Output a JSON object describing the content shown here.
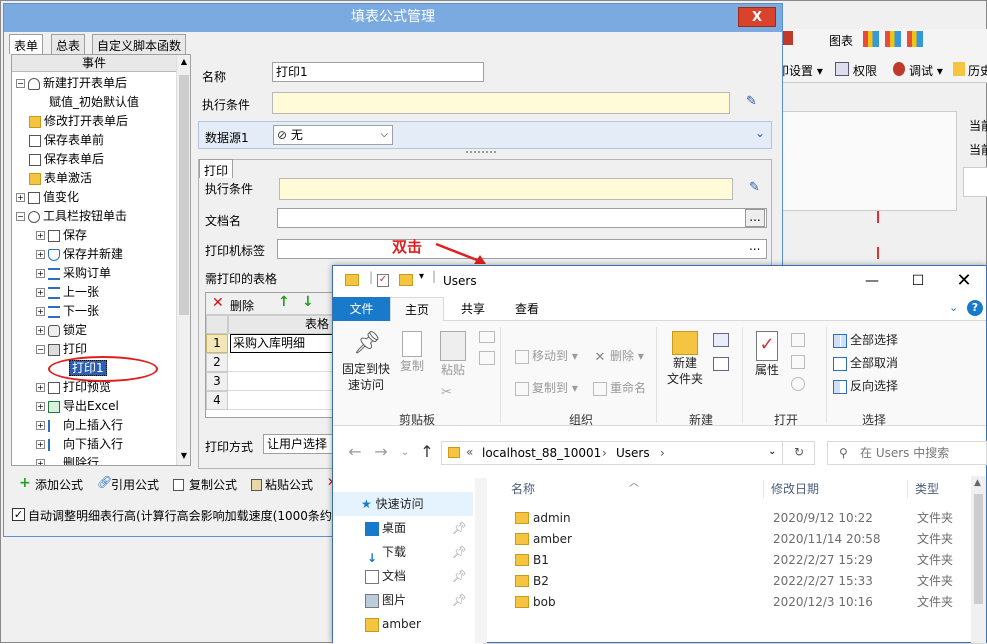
{
  "bg_app": {
    "toolbar_items": [
      "图表",
      "印设置 ▾",
      "权限",
      "调试 ▾",
      "历史"
    ],
    "side_labels": [
      "当前",
      "当前"
    ]
  },
  "dialog": {
    "title": "填表公式管理",
    "close_label": "X",
    "tabs": [
      "表单",
      "总表",
      "自定义脚本函数"
    ],
    "tree_header": "事件",
    "tree": [
      {
        "label": "新建打开表单后",
        "level": 0,
        "exp": "−",
        "icon": "person"
      },
      {
        "label": "赋值_初始默认值",
        "level": 1,
        "exp": "",
        "icon": "none"
      },
      {
        "label": "修改打开表单后",
        "level": 0,
        "exp": "",
        "icon": "folder"
      },
      {
        "label": "保存表单前",
        "level": 0,
        "exp": "",
        "icon": "doc"
      },
      {
        "label": "保存表单后",
        "level": 0,
        "exp": "",
        "icon": "doc"
      },
      {
        "label": "表单激活",
        "level": 0,
        "exp": "",
        "icon": "folder"
      },
      {
        "label": "值变化",
        "level": 0,
        "exp": "+",
        "icon": "value"
      },
      {
        "label": "工具栏按钮单击",
        "level": 0,
        "exp": "−",
        "icon": "search"
      },
      {
        "label": "保存",
        "level": 1,
        "exp": "+",
        "icon": "doc"
      },
      {
        "label": "保存并新建",
        "level": 1,
        "exp": "+",
        "icon": "shield"
      },
      {
        "label": "采购订单",
        "level": 1,
        "exp": "+",
        "icon": "stack"
      },
      {
        "label": "上一张",
        "level": 1,
        "exp": "+",
        "icon": "stack"
      },
      {
        "label": "下一张",
        "level": 1,
        "exp": "+",
        "icon": "stack"
      },
      {
        "label": "锁定",
        "level": 1,
        "exp": "+",
        "icon": "lock"
      },
      {
        "label": "打印",
        "level": 1,
        "exp": "−",
        "icon": "print"
      },
      {
        "label": "打印1",
        "level": 2,
        "exp": "",
        "icon": "none",
        "selected": true
      },
      {
        "label": "打印预览",
        "level": 1,
        "exp": "+",
        "icon": "preview"
      },
      {
        "label": "导出Excel",
        "level": 1,
        "exp": "+",
        "icon": "excel"
      },
      {
        "label": "向上插入行",
        "level": 1,
        "exp": "+",
        "icon": "insert"
      },
      {
        "label": "向下插入行",
        "level": 1,
        "exp": "+",
        "icon": "insert"
      },
      {
        "label": "删除行",
        "level": 1,
        "exp": "+",
        "icon": "delete"
      }
    ],
    "bottom_buttons": [
      "添加公式",
      "引用公式",
      "复制公式",
      "粘贴公式"
    ],
    "auto_adjust_label": "自动调整明细表行高(计算行高会影响加载速度(1000条约1秒",
    "form": {
      "name_label": "名称",
      "name_value": "打印1",
      "cond_label": "执行条件",
      "datasource_label": "数据源1",
      "datasource_value": "无",
      "print_group_tab": "打印",
      "print_cond_label": "执行条件",
      "docname_label": "文档名",
      "ellipsis": "...",
      "printer_label": "打印机标签",
      "table_label": "需打印的表格",
      "delete_label": "删除",
      "grid_col_header": "表格",
      "grid_rows": [
        "1",
        "2",
        "3",
        "4"
      ],
      "grid_row1_value": "采购入库明细",
      "print_mode_label": "打印方式",
      "print_mode_value": "让用户选择"
    }
  },
  "annotation": {
    "text": "双击",
    "color": "#e02020"
  },
  "explorer": {
    "title": "Users",
    "tabs": [
      "文件",
      "主页",
      "共享",
      "查看"
    ],
    "ribbon": {
      "clipboard": {
        "name": "剪贴板",
        "pin": "固定到快\n速访问",
        "copy": "复制",
        "paste": "粘贴"
      },
      "organize": {
        "name": "组织",
        "move": "移动到 ▾",
        "copyto": "复制到 ▾",
        "delete": "删除 ▾",
        "rename": "重命名"
      },
      "new": {
        "name": "新建",
        "newfolder": "新建\n文件夹"
      },
      "open": {
        "name": "打开",
        "props": "属性"
      },
      "select": {
        "name": "选择",
        "all": "全部选择",
        "none": "全部取消",
        "invert": "反向选择"
      }
    },
    "address": [
      "localhost_88_10001",
      "Users"
    ],
    "address_prefix": "«",
    "search_placeholder": "在 Users 中搜索",
    "nav": [
      "快速访问",
      "桌面",
      "下载",
      "文档",
      "图片",
      "amber"
    ],
    "columns": [
      "名称",
      "修改日期",
      "类型"
    ],
    "files": [
      {
        "name": "admin",
        "date": "2020/9/12 10:22",
        "type": "文件夹"
      },
      {
        "name": "amber",
        "date": "2020/11/14 20:58",
        "type": "文件夹"
      },
      {
        "name": "B1",
        "date": "2022/2/27 15:29",
        "type": "文件夹"
      },
      {
        "name": "B2",
        "date": "2022/2/27 15:33",
        "type": "文件夹"
      },
      {
        "name": "bob",
        "date": "2020/12/3 10:16",
        "type": "文件夹"
      }
    ]
  }
}
